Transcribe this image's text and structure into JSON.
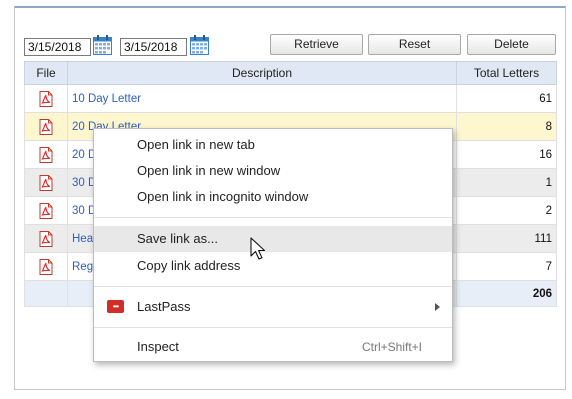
{
  "toolbar": {
    "date_from": "3/15/2018",
    "date_to": "3/15/2018",
    "retrieve_label": "Retrieve",
    "reset_label": "Reset",
    "delete_label": "Delete"
  },
  "table": {
    "headers": [
      "File",
      "Description",
      "Total Letters"
    ],
    "rows": [
      {
        "description": "10 Day Letter",
        "total": "61"
      },
      {
        "description": "20 Day Letter",
        "total": "8"
      },
      {
        "description": "20 D",
        "total": "16"
      },
      {
        "description": "30 D",
        "total": "1"
      },
      {
        "description": "30 D",
        "total": "2"
      },
      {
        "description": "Hea",
        "total": "111"
      },
      {
        "description": "Reg",
        "total": "7"
      }
    ],
    "grand_total": "206"
  },
  "context_menu": {
    "items": [
      {
        "label": "Open link in new tab"
      },
      {
        "label": "Open link in new window"
      },
      {
        "label": "Open link in incognito window"
      },
      {
        "label": "Save link as..."
      },
      {
        "label": "Copy link address"
      },
      {
        "label": "LastPass"
      },
      {
        "label": "Inspect",
        "shortcut": "Ctrl+Shift+I"
      }
    ],
    "lastpass_icon_text": "•••"
  },
  "icons": {
    "calendar": "calendar-icon",
    "file": "pdf-file-icon",
    "submenu": "chevron-right-icon",
    "cursor": "mouse-pointer-icon"
  },
  "colors": {
    "header_bg": "#dfe8f4",
    "highlight_row": "#fdf6cf",
    "link": "#2f5fbf",
    "lastpass_red": "#d32d27"
  }
}
